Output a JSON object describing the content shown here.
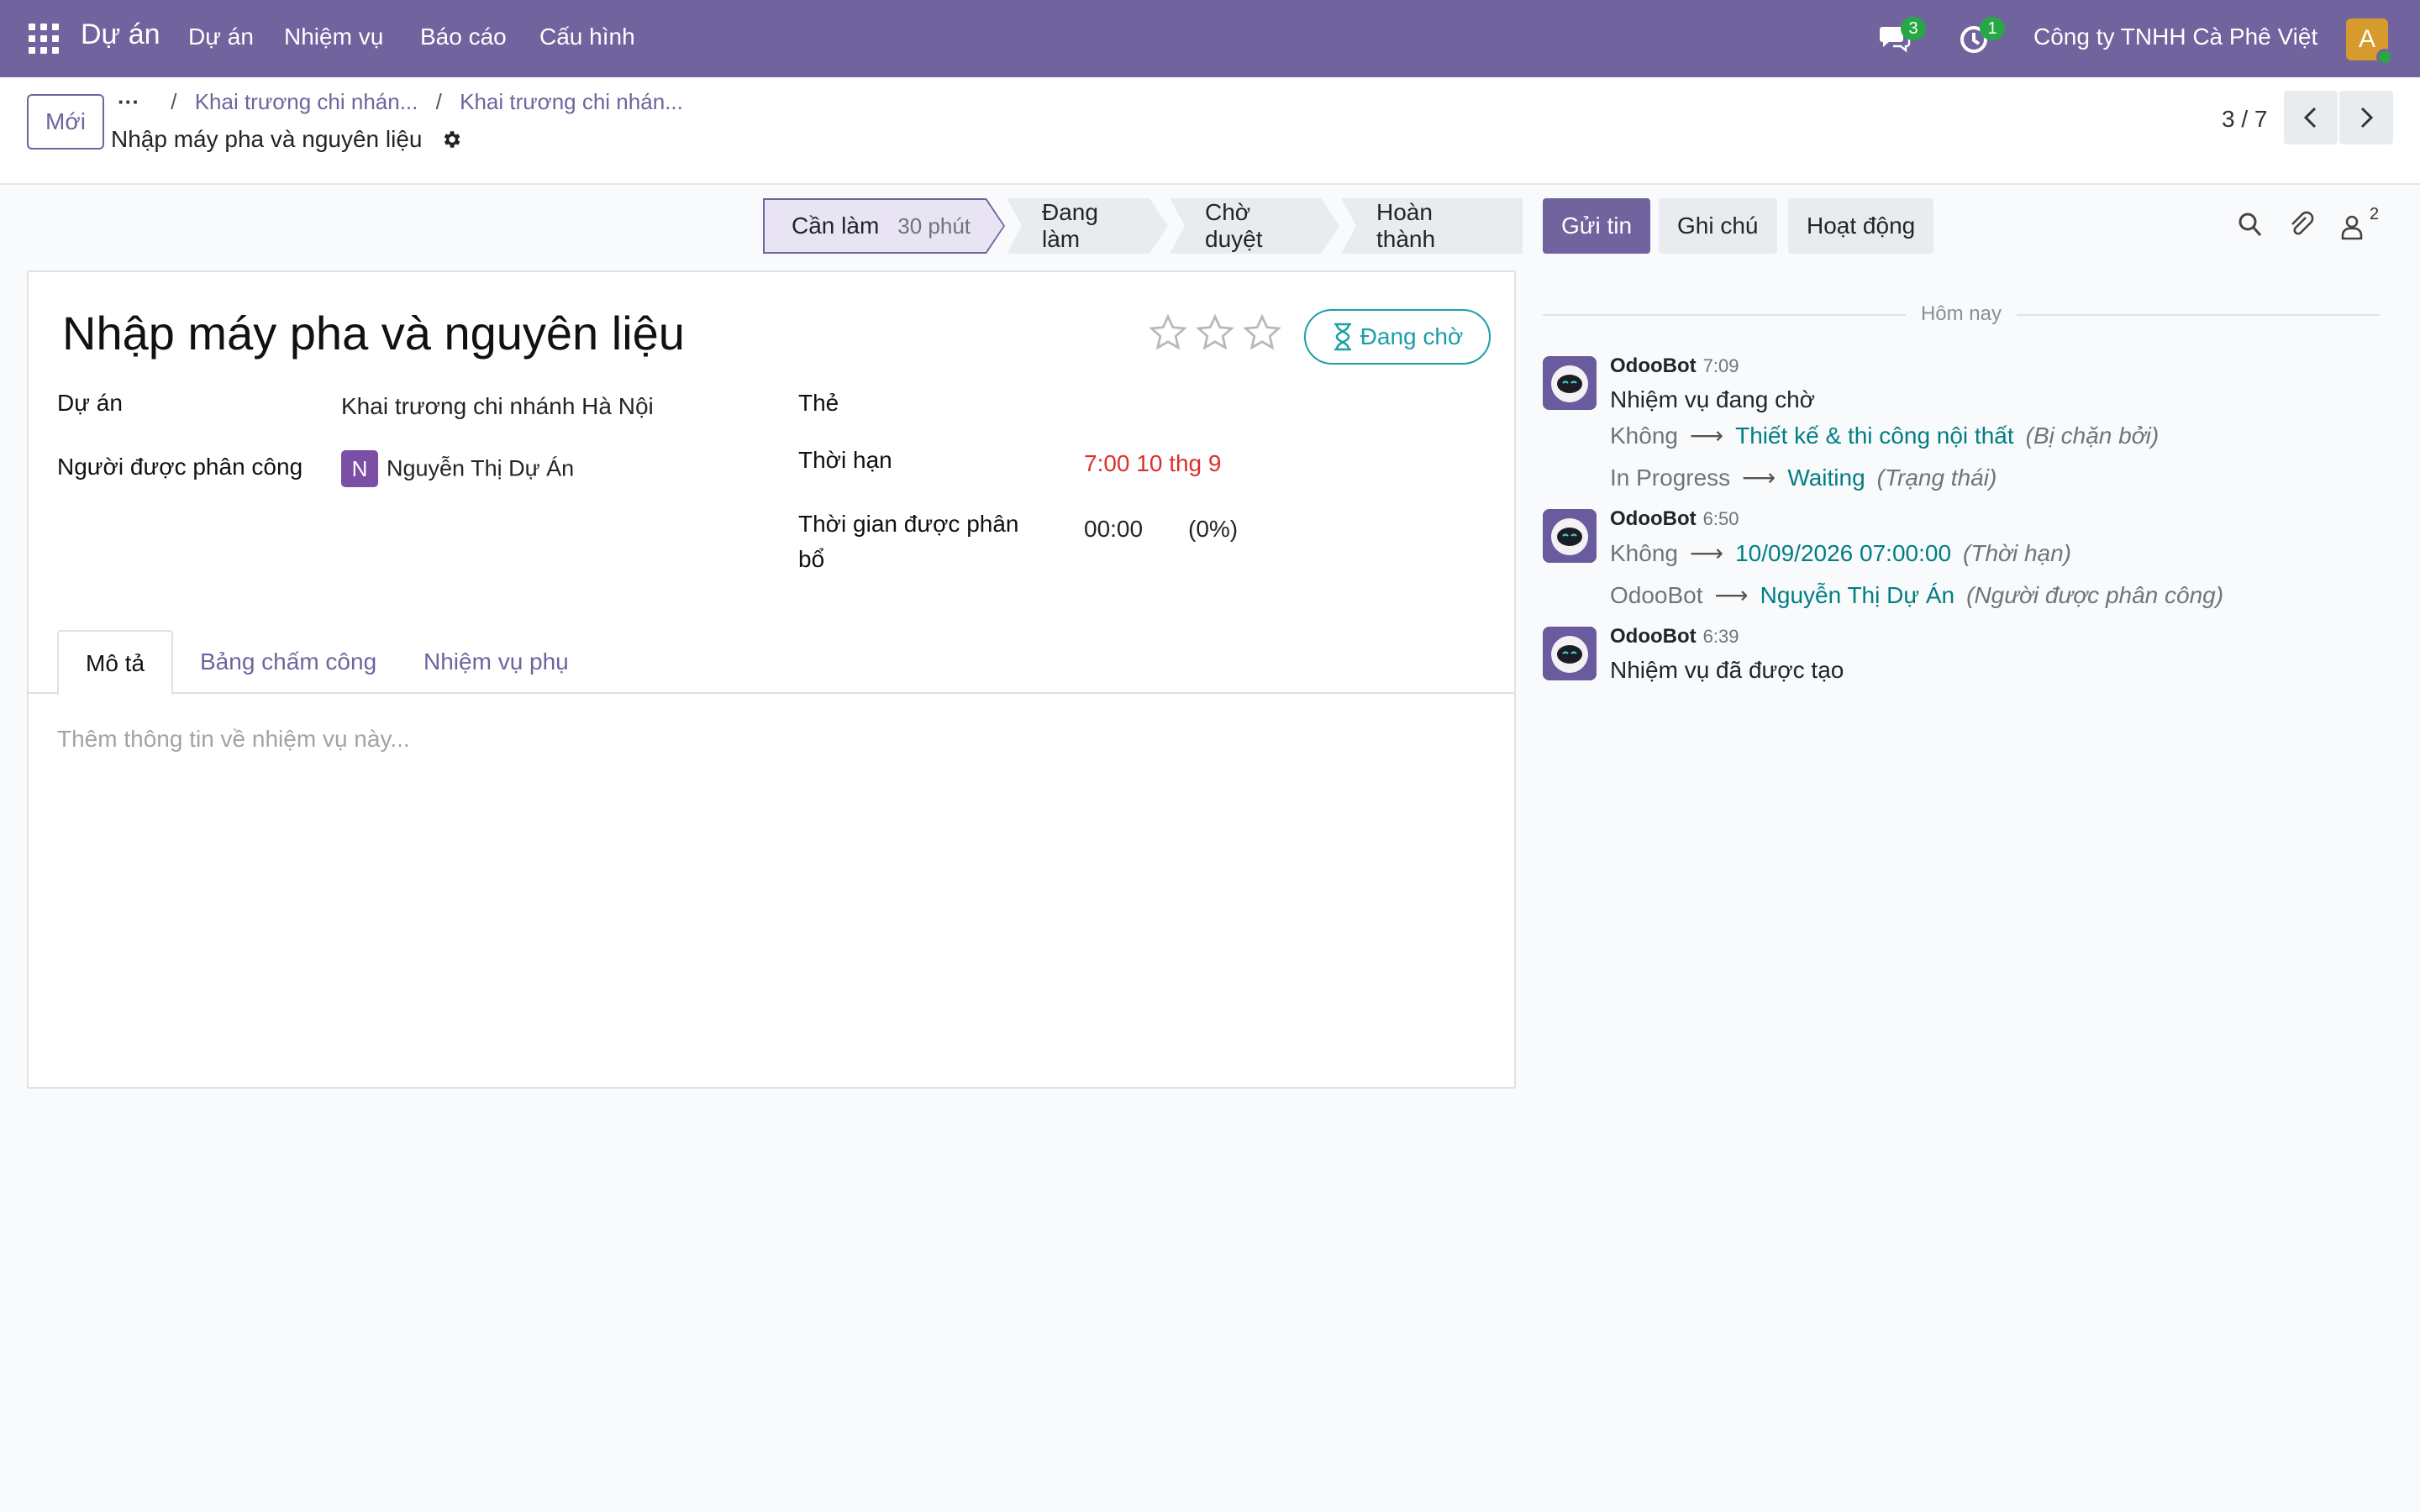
{
  "topnav": {
    "brand": "Dự án",
    "menu": [
      "Dự án",
      "Nhiệm vụ",
      "Báo cáo",
      "Cấu hình"
    ],
    "messages_count": "3",
    "activities_count": "1",
    "company": "Công ty TNHH Cà Phê Việt",
    "user_initial": "A"
  },
  "control": {
    "new_label": "Mới",
    "breadcrumb_ellipsis": "···",
    "breadcrumbs": [
      "Khai trương chi nhán...",
      "Khai trương chi nhán..."
    ],
    "record_title": "Nhập máy pha và nguyên liệu",
    "pager": "3 / 7"
  },
  "statusbar": {
    "stages": [
      {
        "label": "Cần làm",
        "duration": "30 phút"
      },
      {
        "label": "Đang làm"
      },
      {
        "label": "Chờ duyệt"
      },
      {
        "label": "Hoàn thành"
      }
    ]
  },
  "form": {
    "title": "Nhập máy pha và nguyên liệu",
    "waiting_label": "Đang chờ",
    "project_label": "Dự án",
    "project_value": "Khai trương chi nhánh Hà Nội",
    "assignee_label": "Người được phân công",
    "assignee_initial": "N",
    "assignee_value": "Nguyễn Thị Dự Án",
    "tags_label": "Thẻ",
    "deadline_label": "Thời hạn",
    "deadline_value": "7:00 10 thg 9",
    "allocated_label_1": "Thời gian được phân",
    "allocated_label_2": "bổ",
    "allocated_value": "00:00",
    "allocated_pct": "(0%)",
    "tabs": [
      "Mô tả",
      "Bảng chấm công",
      "Nhiệm vụ phụ"
    ],
    "description_placeholder": "Thêm thông tin về nhiệm vụ này..."
  },
  "chatter": {
    "send_label": "Gửi tin",
    "note_label": "Ghi chú",
    "activity_label": "Hoạt động",
    "followers_count": "2",
    "today_label": "Hôm nay",
    "messages": [
      {
        "author": "OdooBot",
        "time": "7:09",
        "body": "Nhiệm vụ đang chờ",
        "changes": [
          {
            "old": "Không",
            "new": "Thiết kế & thi công nội thất",
            "field": "(Bị chặn bởi)"
          },
          {
            "old": "In Progress",
            "new": "Waiting",
            "field": "(Trạng thái)"
          }
        ]
      },
      {
        "author": "OdooBot",
        "time": "6:50",
        "changes": [
          {
            "old": "Không",
            "new": "10/09/2026 07:00:00",
            "field": "(Thời hạn)"
          },
          {
            "old": "OdooBot",
            "new": "Nguyễn Thị Dự Án",
            "field": "(Người được phân công)"
          }
        ]
      },
      {
        "author": "OdooBot",
        "time": "6:39",
        "body": "Nhiệm vụ đã được tạo"
      }
    ]
  },
  "colors": {
    "brand": "#71639e",
    "link": "#017e84",
    "deadline": "#d9302b",
    "waiting": "#1a9fa6"
  }
}
